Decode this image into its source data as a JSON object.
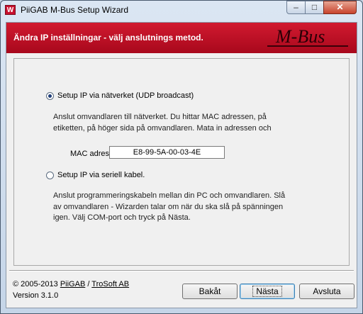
{
  "window": {
    "title": "PiiGAB M-Bus Setup Wizard",
    "icon_letter": "W",
    "controls": {
      "minimize": "–",
      "maximize": "□",
      "close": "✕"
    }
  },
  "banner": {
    "title": "Ändra IP inställningar - välj anslutnings metod.",
    "logo_text": "M-Bus",
    "color": "#c8102e"
  },
  "options": {
    "network": {
      "label": "Setup IP via nätverket (UDP broadcast)",
      "selected": true,
      "description_lines": [
        "Anslut omvandlaren till nätverket. Du hittar MAC adressen, på",
        "etiketten, på höger sida på omvandlaren. Mata in adressen och"
      ]
    },
    "serial": {
      "label": "Setup IP via seriell kabel.",
      "selected": false,
      "description_lines": [
        "Anslut programmeringskabeln mellan din PC och omvandlaren. Slå",
        "av omvandlaren - Wizarden talar om när du ska slå på spänningen",
        "igen. Välj COM-port och tryck på Nästa."
      ]
    }
  },
  "mac": {
    "label": "MAC adress:",
    "value": "E8-99-5A-00-03-4E"
  },
  "footer": {
    "copyright_prefix": "© 2005-2013",
    "company1": "PiiGAB",
    "separator": "/",
    "company2": "TroSoft AB",
    "version": "Version 3.1.0"
  },
  "buttons": {
    "back": "Bakåt",
    "next": "Nästa",
    "exit": "Avsluta"
  }
}
